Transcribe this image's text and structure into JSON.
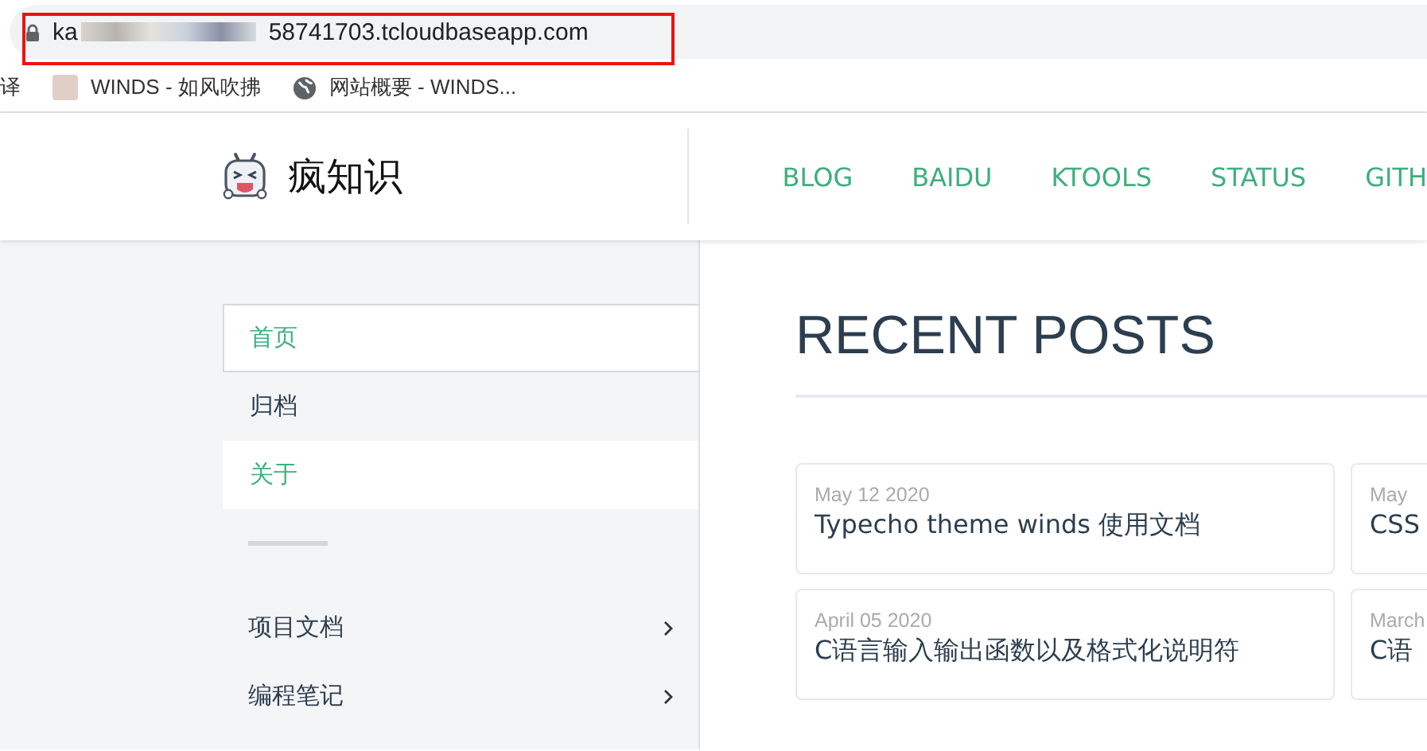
{
  "browser": {
    "address_start": "ka",
    "address_end": "58741703.tcloudbaseapp.com",
    "bookmarks": [
      {
        "label": "译",
        "kind": "plain"
      },
      {
        "label": "WINDS - 如风吹拂",
        "kind": "avatar"
      },
      {
        "label": "网站概要 - WINDS...",
        "kind": "site"
      }
    ]
  },
  "header": {
    "site_title": "疯知识",
    "nav": [
      {
        "label": "BLOG"
      },
      {
        "label": "BAIDU"
      },
      {
        "label": "KTOOLS"
      },
      {
        "label": "STATUS"
      },
      {
        "label": "GITH"
      }
    ]
  },
  "sidebar": {
    "items": [
      {
        "label": "首页",
        "kind": "link",
        "selected": true,
        "highlighted": true
      },
      {
        "label": "归档",
        "kind": "link",
        "selected": false,
        "highlighted": false
      },
      {
        "label": "关于",
        "kind": "link",
        "selected": false,
        "highlighted": true
      },
      {
        "kind": "divider"
      },
      {
        "label": "项目文档",
        "kind": "group"
      },
      {
        "label": "编程笔记",
        "kind": "group"
      }
    ]
  },
  "main": {
    "heading": "RECENT POSTS",
    "posts": [
      {
        "date": "May 12 2020",
        "title": "Typecho theme winds 使用文档"
      },
      {
        "date": "May",
        "title": "CSS"
      },
      {
        "date": "April 05 2020",
        "title": "C语言输入输出函数以及格式化说明符"
      },
      {
        "date": "March",
        "title": "C语"
      }
    ]
  }
}
